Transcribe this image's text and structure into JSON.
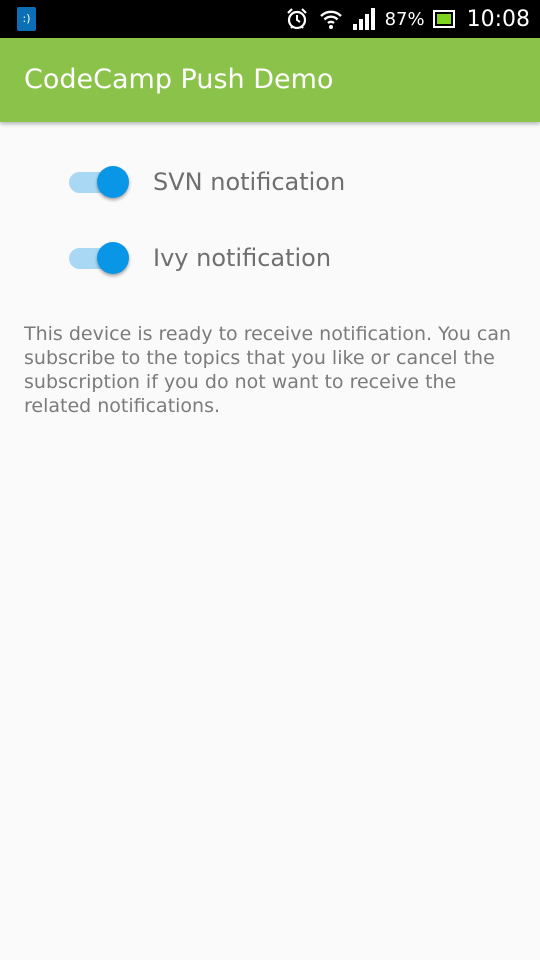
{
  "status_bar": {
    "notification_icon": ":)",
    "battery_percent": "87%",
    "time": "10:08",
    "icons": [
      "notification-icon",
      "alarm-icon",
      "wifi-icon",
      "signal-icon",
      "battery-icon"
    ]
  },
  "app_bar": {
    "title": "CodeCamp Push Demo",
    "color": "#8bc34a"
  },
  "switches": [
    {
      "label": "SVN notification",
      "checked": true
    },
    {
      "label": "Ivy notification",
      "checked": true
    }
  ],
  "info_text": "This device is ready to receive notification. You can subscribe to the topics that you like or cancel the subscription if you do not want to receive the related notifications.",
  "colors": {
    "accent": "#0a96e6",
    "track": "#a9d8f5",
    "background": "#fafafa"
  }
}
